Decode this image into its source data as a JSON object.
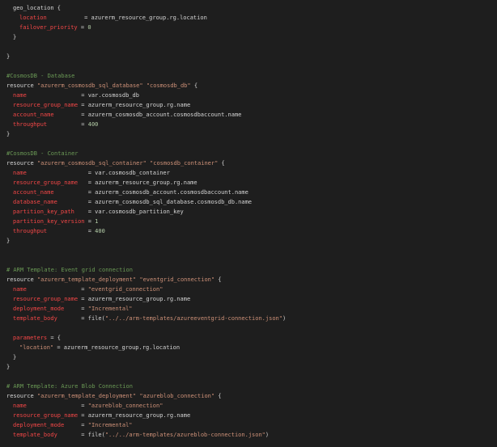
{
  "editor": {
    "lines": [
      {
        "indent": 0,
        "tokens": [
          {
            "t": "plain",
            "v": "geo_location {"
          }
        ]
      },
      {
        "indent": 1,
        "tokens": [
          {
            "t": "attr",
            "v": "location"
          },
          {
            "t": "plain",
            "v": "           = azurerm_resource_group.rg.location"
          }
        ]
      },
      {
        "indent": 1,
        "tokens": [
          {
            "t": "attr",
            "v": "failover_priority"
          },
          {
            "t": "plain",
            "v": " = "
          },
          {
            "t": "number",
            "v": "0"
          }
        ]
      },
      {
        "indent": 0,
        "tokens": [
          {
            "t": "plain",
            "v": "}"
          }
        ]
      },
      {
        "indent": 0,
        "tokens": []
      },
      {
        "indent": -1,
        "tokens": [
          {
            "t": "plain",
            "v": "}"
          }
        ]
      },
      {
        "indent": 0,
        "tokens": []
      },
      {
        "indent": -1,
        "tokens": [
          {
            "t": "comment",
            "v": "#CosmosDB - Database"
          }
        ]
      },
      {
        "indent": -1,
        "tokens": [
          {
            "t": "plain",
            "v": "resource "
          },
          {
            "t": "string",
            "v": "\"azurerm_cosmosdb_sql_database\""
          },
          {
            "t": "plain",
            "v": " "
          },
          {
            "t": "string",
            "v": "\"cosmosdb_db\""
          },
          {
            "t": "plain",
            "v": " {"
          }
        ]
      },
      {
        "indent": 0,
        "tokens": [
          {
            "t": "attr",
            "v": "name"
          },
          {
            "t": "plain",
            "v": "                = var.cosmosdb_db"
          }
        ]
      },
      {
        "indent": 0,
        "tokens": [
          {
            "t": "attr",
            "v": "resource_group_name"
          },
          {
            "t": "plain",
            "v": " = azurerm_resource_group.rg.name"
          }
        ]
      },
      {
        "indent": 0,
        "tokens": [
          {
            "t": "attr",
            "v": "account_name"
          },
          {
            "t": "plain",
            "v": "        = azurerm_cosmosdb_account.cosmosdbaccount.name"
          }
        ]
      },
      {
        "indent": 0,
        "tokens": [
          {
            "t": "attr",
            "v": "throughput"
          },
          {
            "t": "plain",
            "v": "          = "
          },
          {
            "t": "number",
            "v": "400"
          }
        ]
      },
      {
        "indent": -1,
        "tokens": [
          {
            "t": "plain",
            "v": "}"
          }
        ]
      },
      {
        "indent": 0,
        "tokens": []
      },
      {
        "indent": -1,
        "tokens": [
          {
            "t": "comment",
            "v": "#CosmosDB - Container"
          }
        ]
      },
      {
        "indent": -1,
        "tokens": [
          {
            "t": "plain",
            "v": "resource "
          },
          {
            "t": "string",
            "v": "\"azurerm_cosmosdb_sql_container\""
          },
          {
            "t": "plain",
            "v": " "
          },
          {
            "t": "string",
            "v": "\"cosmosdb_container\""
          },
          {
            "t": "plain",
            "v": " {"
          }
        ]
      },
      {
        "indent": 0,
        "tokens": [
          {
            "t": "attr",
            "v": "name"
          },
          {
            "t": "plain",
            "v": "                  = var.cosmosdb_container"
          }
        ]
      },
      {
        "indent": 0,
        "tokens": [
          {
            "t": "attr",
            "v": "resource_group_name"
          },
          {
            "t": "plain",
            "v": "   = azurerm_resource_group.rg.name"
          }
        ]
      },
      {
        "indent": 0,
        "tokens": [
          {
            "t": "attr",
            "v": "account_name"
          },
          {
            "t": "plain",
            "v": "          = azurerm_cosmosdb_account.cosmosdbaccount.name"
          }
        ]
      },
      {
        "indent": 0,
        "tokens": [
          {
            "t": "attr",
            "v": "database_name"
          },
          {
            "t": "plain",
            "v": "         = azurerm_cosmosdb_sql_database.cosmosdb_db.name"
          }
        ]
      },
      {
        "indent": 0,
        "tokens": [
          {
            "t": "attr",
            "v": "partition_key_path"
          },
          {
            "t": "plain",
            "v": "    = var.cosmosdb_partition_key"
          }
        ]
      },
      {
        "indent": 0,
        "tokens": [
          {
            "t": "attr",
            "v": "partition_key_version"
          },
          {
            "t": "plain",
            "v": " = "
          },
          {
            "t": "number",
            "v": "1"
          }
        ]
      },
      {
        "indent": 0,
        "tokens": [
          {
            "t": "attr",
            "v": "throughput"
          },
          {
            "t": "plain",
            "v": "            = "
          },
          {
            "t": "number",
            "v": "400"
          }
        ]
      },
      {
        "indent": -1,
        "tokens": [
          {
            "t": "plain",
            "v": "}"
          }
        ]
      },
      {
        "indent": 0,
        "tokens": []
      },
      {
        "indent": 0,
        "tokens": []
      },
      {
        "indent": -1,
        "tokens": [
          {
            "t": "comment",
            "v": "# ARM Template: Event grid connection"
          }
        ]
      },
      {
        "indent": -1,
        "tokens": [
          {
            "t": "plain",
            "v": "resource "
          },
          {
            "t": "string",
            "v": "\"azurerm_template_deployment\""
          },
          {
            "t": "plain",
            "v": " "
          },
          {
            "t": "string",
            "v": "\"eventgrid_connection\""
          },
          {
            "t": "plain",
            "v": " {"
          }
        ]
      },
      {
        "indent": 0,
        "tokens": [
          {
            "t": "attr",
            "v": "name"
          },
          {
            "t": "plain",
            "v": "                = "
          },
          {
            "t": "string",
            "v": "\"eventgrid_connection\""
          }
        ]
      },
      {
        "indent": 0,
        "tokens": [
          {
            "t": "attr",
            "v": "resource_group_name"
          },
          {
            "t": "plain",
            "v": " = azurerm_resource_group.rg.name"
          }
        ]
      },
      {
        "indent": 0,
        "tokens": [
          {
            "t": "attr",
            "v": "deployment_mode"
          },
          {
            "t": "plain",
            "v": "     = "
          },
          {
            "t": "string",
            "v": "\"Incremental\""
          }
        ]
      },
      {
        "indent": 0,
        "tokens": [
          {
            "t": "attr",
            "v": "template_body"
          },
          {
            "t": "plain",
            "v": "       = file("
          },
          {
            "t": "string",
            "v": "\"../../arm-templates/azureeventgrid-connection.json\""
          },
          {
            "t": "plain",
            "v": ")"
          }
        ]
      },
      {
        "indent": 0,
        "tokens": []
      },
      {
        "indent": 0,
        "tokens": [
          {
            "t": "attr",
            "v": "parameters"
          },
          {
            "t": "plain",
            "v": " = {"
          }
        ]
      },
      {
        "indent": 1,
        "tokens": [
          {
            "t": "string",
            "v": "\"location\""
          },
          {
            "t": "plain",
            "v": " = azurerm_resource_group.rg.location"
          }
        ]
      },
      {
        "indent": 0,
        "tokens": [
          {
            "t": "plain",
            "v": "}"
          }
        ]
      },
      {
        "indent": -1,
        "tokens": [
          {
            "t": "plain",
            "v": "}"
          }
        ]
      },
      {
        "indent": 0,
        "tokens": []
      },
      {
        "indent": -1,
        "tokens": [
          {
            "t": "comment",
            "v": "# ARM Template: Azure Blob Connection"
          }
        ]
      },
      {
        "indent": -1,
        "tokens": [
          {
            "t": "plain",
            "v": "resource "
          },
          {
            "t": "string",
            "v": "\"azurerm_template_deployment\""
          },
          {
            "t": "plain",
            "v": " "
          },
          {
            "t": "string",
            "v": "\"azureblob_connection\""
          },
          {
            "t": "plain",
            "v": " {"
          }
        ]
      },
      {
        "indent": 0,
        "tokens": [
          {
            "t": "attr",
            "v": "name"
          },
          {
            "t": "plain",
            "v": "                = "
          },
          {
            "t": "string",
            "v": "\"azureblob_connection\""
          }
        ]
      },
      {
        "indent": 0,
        "tokens": [
          {
            "t": "attr",
            "v": "resource_group_name"
          },
          {
            "t": "plain",
            "v": " = azurerm_resource_group.rg.name"
          }
        ]
      },
      {
        "indent": 0,
        "tokens": [
          {
            "t": "attr",
            "v": "deployment_mode"
          },
          {
            "t": "plain",
            "v": "     = "
          },
          {
            "t": "string",
            "v": "\"Incremental\""
          }
        ]
      },
      {
        "indent": 0,
        "tokens": [
          {
            "t": "attr",
            "v": "template_body"
          },
          {
            "t": "plain",
            "v": "       = file("
          },
          {
            "t": "string",
            "v": "\"../../arm-templates/azureblob-connection.json\""
          },
          {
            "t": "plain",
            "v": ")"
          }
        ]
      }
    ]
  },
  "colors": {
    "background": "#1e1e1e",
    "comment": "#6a9955",
    "string": "#ce9178",
    "attribute": "#f44747",
    "number": "#b5cea8",
    "text": "#d4d4d4"
  }
}
